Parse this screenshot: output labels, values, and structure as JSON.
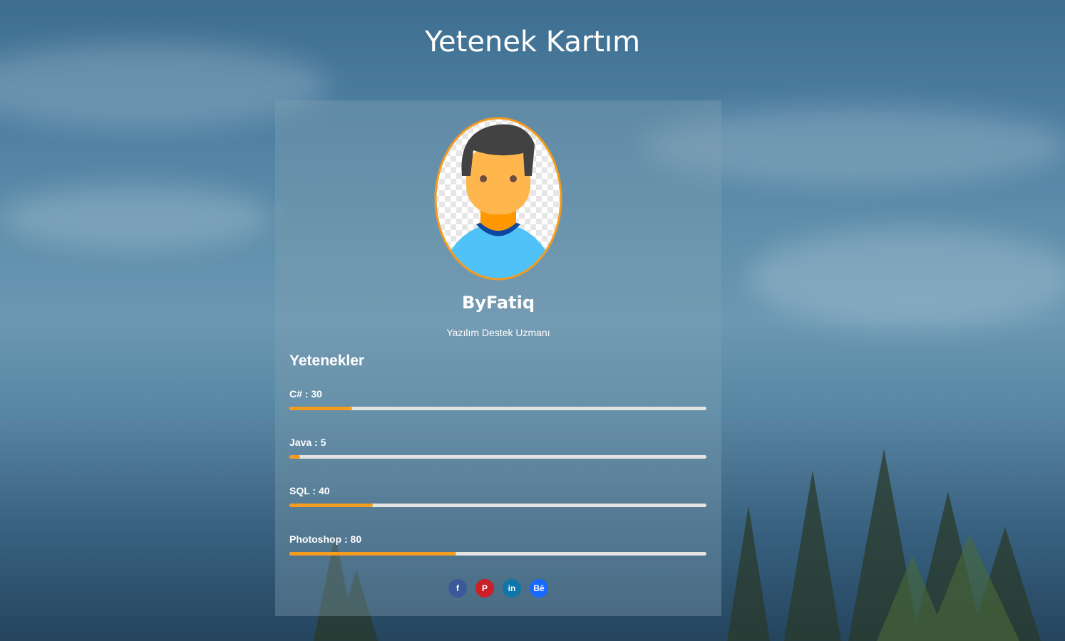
{
  "page": {
    "title": "Yetenek Kartım"
  },
  "profile": {
    "name": "ByFatiq",
    "role": "Yazılım Destek Uzmanı",
    "avatar_icon": "user-avatar-icon"
  },
  "skills_section": {
    "heading": "Yetenekler",
    "items": [
      {
        "label": "C# : 30",
        "level": 15
      },
      {
        "label": "Java : 5",
        "level": 2.5
      },
      {
        "label": "SQL : 40",
        "level": 20
      },
      {
        "label": "Photoshop : 80",
        "level": 40
      }
    ]
  },
  "social": [
    {
      "name": "facebook-icon",
      "glyph": "f",
      "color": "#3b5998"
    },
    {
      "name": "pinterest-icon",
      "glyph": "P",
      "color": "#cb2027"
    },
    {
      "name": "linkedin-icon",
      "glyph": "in",
      "color": "#0e76a8"
    },
    {
      "name": "behance-icon",
      "glyph": "Bē",
      "color": "#1769ff"
    }
  ],
  "colors": {
    "accent": "#f39c1f",
    "track": "#e4e4e4"
  }
}
